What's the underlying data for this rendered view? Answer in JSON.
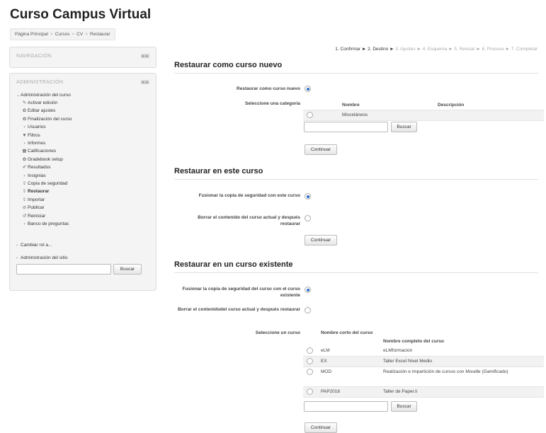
{
  "page": {
    "title": "Curso Campus Virtual",
    "breadcrumb": [
      "Página Principal",
      "Cursos",
      "CV",
      "Restaurar"
    ]
  },
  "nav_block": {
    "title": "NAVEGACIÓN",
    "controls": "▣▣"
  },
  "admin_block": {
    "title": "ADMINISTRACIÓN",
    "controls": "▣▣",
    "course_admin": "Administración del curso",
    "items": [
      {
        "label": "Activar edición",
        "icon": "pencil-icon",
        "glyph": "✎"
      },
      {
        "label": "Editar ajustes",
        "icon": "gear-icon",
        "glyph": "✿"
      },
      {
        "label": "Finalización del curso",
        "icon": "gear-icon",
        "glyph": "✿"
      },
      {
        "label": "Usuarios",
        "icon": "arrow-icon",
        "glyph": "›"
      },
      {
        "label": "Filtros",
        "icon": "filter-icon",
        "glyph": "▼"
      },
      {
        "label": "Informes",
        "icon": "arrow-icon",
        "glyph": "›"
      },
      {
        "label": "Calificaciones",
        "icon": "grid-icon",
        "glyph": "▦"
      },
      {
        "label": "Gradebook setup",
        "icon": "gear-icon",
        "glyph": "✿"
      },
      {
        "label": "Resultados",
        "icon": "outcomes-icon",
        "glyph": "✐"
      },
      {
        "label": "Insignias",
        "icon": "arrow-icon",
        "glyph": "›"
      },
      {
        "label": "Copia de seguridad",
        "icon": "backup-icon",
        "glyph": "⇪"
      },
      {
        "label": "Restaurar",
        "icon": "restore-icon",
        "glyph": "⇪"
      },
      {
        "label": "Importar",
        "icon": "import-icon",
        "glyph": "⇪"
      },
      {
        "label": "Publicar",
        "icon": "publish-icon",
        "glyph": "⊘"
      },
      {
        "label": "Reiniciar",
        "icon": "reset-icon",
        "glyph": "↺"
      },
      {
        "label": "Banco de preguntas",
        "icon": "arrow-icon",
        "glyph": "›"
      }
    ],
    "switch_role": "Cambiar rol a...",
    "site_admin": "Administración del sitio",
    "search_button": "Buscar"
  },
  "steps": {
    "done": "1. Confirmar ► 2. Destino ►",
    "pending": "3. Ajustes ► 4. Esquema ► 5. Revisar ► 6. Proceso ► 7. Completar"
  },
  "section_new": {
    "title": "Restaurar como curso nuevo",
    "restore_label": "Restaurar como curso nuevo",
    "category_label": "Seleccione una categoría",
    "col_name": "Nombre",
    "col_desc": "Descripción",
    "category": "Misceláneos",
    "search_button": "Buscar",
    "continue_button": "Continuar"
  },
  "section_this": {
    "title": "Restaurar en este curso",
    "merge_label": "Fusionar la copia de seguridad con este curso",
    "delete_label": "Borrar el contenido del curso actual y después restaurar",
    "continue_button": "Continuar"
  },
  "section_existing": {
    "title": "Restaurar en un curso existente",
    "merge_label": "Fusionar la copia de seguridad del curso con el curso existente",
    "delete_label": "Borrar el contenidodel curso actual y después restaurar",
    "select_label": "Seleccione un curso",
    "col_short": "Nombre corto del curso",
    "col_full": "Nombre completo del curso",
    "courses": [
      {
        "short": "eLM",
        "full": "eLMformacion"
      },
      {
        "short": "EX",
        "full": "Taller Excel Nivel Medio"
      },
      {
        "short": "MOD",
        "full": "Realización e impartición de cursos con Moodle (Gamificado)"
      },
      {
        "short": "PAP2018",
        "full": "Taller de Paper.li"
      }
    ],
    "search_button": "Buscar",
    "continue_button": "Continuar"
  }
}
